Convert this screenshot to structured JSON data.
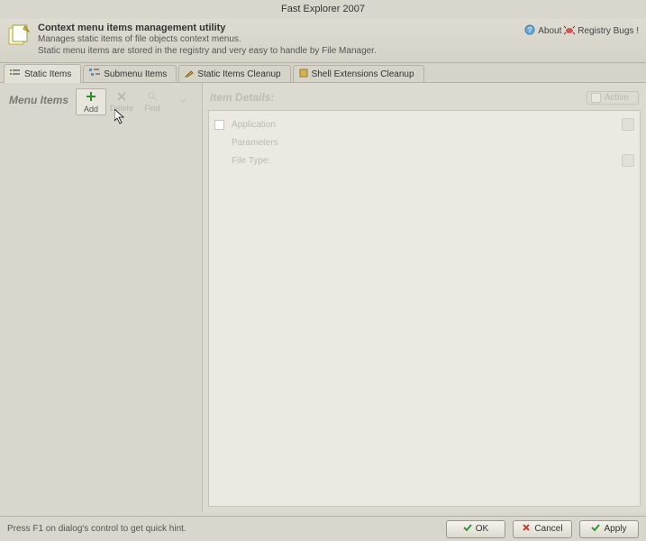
{
  "window": {
    "title": "Fast Explorer 2007"
  },
  "header": {
    "title": "Context menu items management utility",
    "line1": "Manages static items of file objects context menus.",
    "line2": "Static menu items are stored in the registry and very easy to handle by File Manager.",
    "about_label": "About",
    "bugs_label": "Registry Bugs !"
  },
  "tabs": {
    "static": "Static Items",
    "submenu": "Submenu Items",
    "cleanup": "Static Items Cleanup",
    "shell": "Shell Extensions Cleanup"
  },
  "left": {
    "heading": "Menu Items",
    "add": "Add",
    "delete": "Delete",
    "find": "Find"
  },
  "right": {
    "heading": "Item Details:",
    "active": "Active",
    "application": "Application",
    "parameters": "Parameters",
    "filetype": "File Type:"
  },
  "status": {
    "hint": "Press F1 on dialog's control to get quick hint."
  },
  "buttons": {
    "ok": "OK",
    "cancel": "Cancel",
    "apply": "Apply"
  }
}
